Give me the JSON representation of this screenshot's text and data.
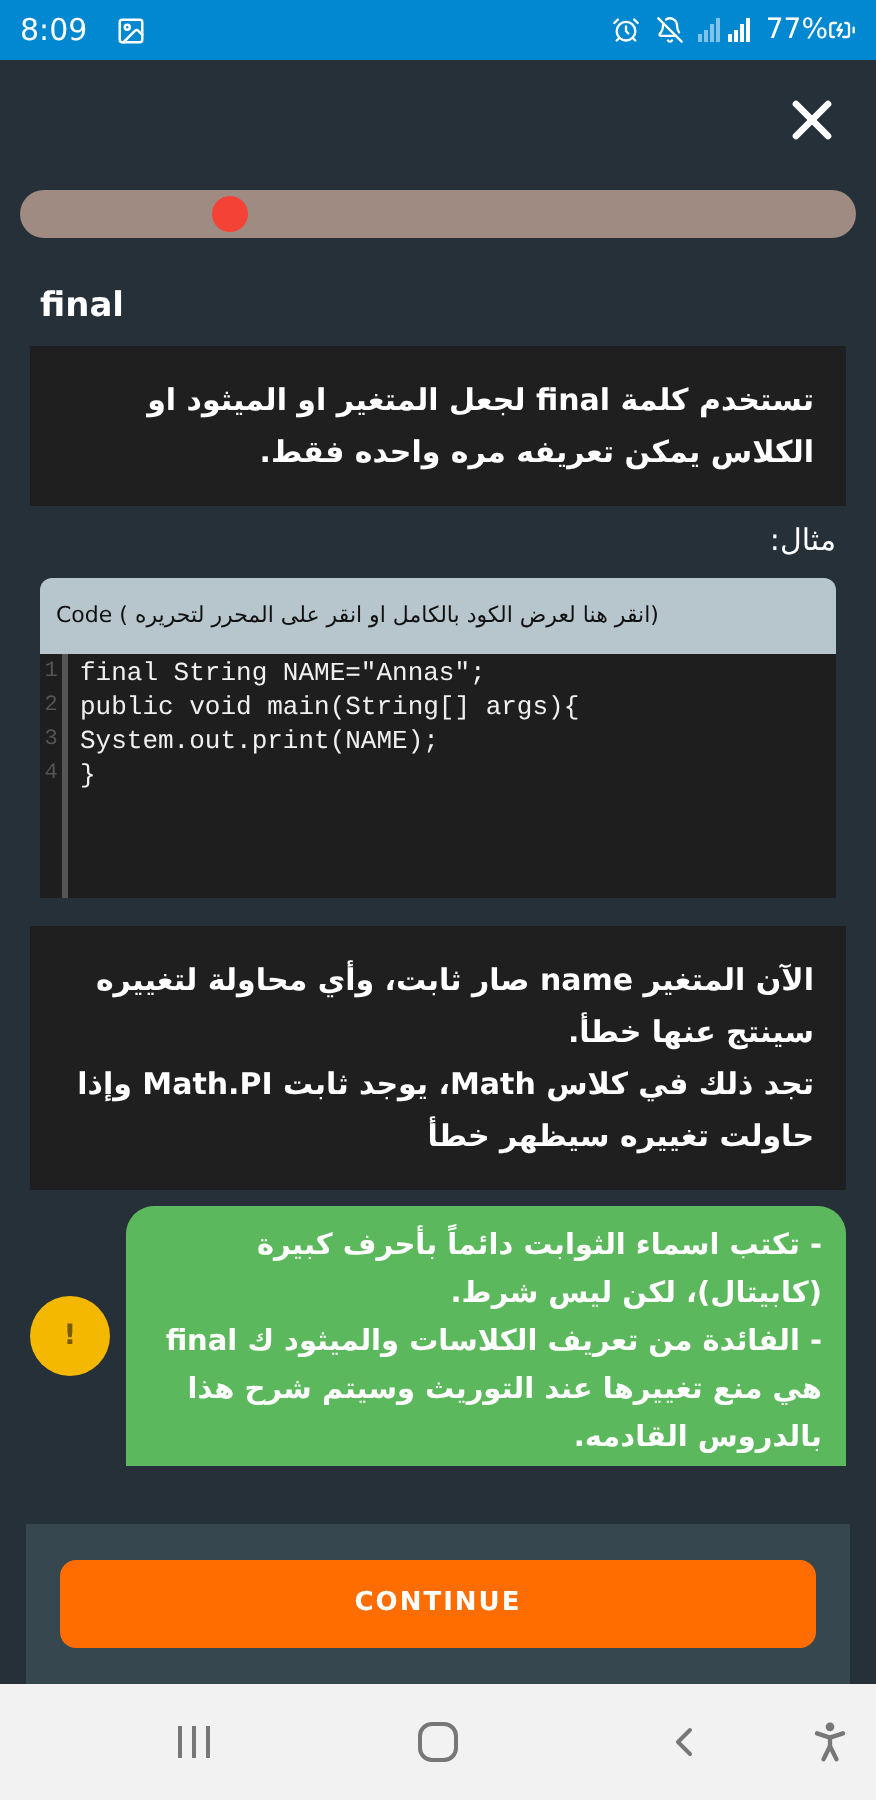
{
  "status_bar": {
    "time": "8:09",
    "battery": "77%"
  },
  "progress": {
    "level": 0.25
  },
  "title": "final",
  "intro": "تستخدم كلمة **final** لجعل المتغير او الميثود او الكلاس يمكن تعريفه مره واحده فقط.",
  "example_label": "مثال:",
  "code": {
    "header": "(انقر هنا لعرض الكود بالكامل او انقر على المحرر لتحريره ) Code",
    "lines": [
      {
        "number": "1",
        "text": "final String NAME=\"Annas\";"
      },
      {
        "number": "2",
        "text": "public void main(String[] args){"
      },
      {
        "number": "3",
        "text": "System.out.print(NAME);"
      },
      {
        "number": "4",
        "text": "}"
      }
    ]
  },
  "explanation": [
    "الآن المتغير **name** صار ثابت، وأي محاولة لتغييره سينتج عنها خطأ.",
    "تجد ذلك في كلاس **Math**، يوجد ثابت **Math.PI** وإذا حاولت تغييره سيظهر خطأ"
  ],
  "tip": {
    "badge": "!",
    "paragraphs": [
      "- تكتب اسماء الثوابت دائماً بأحرف كبيرة (كابيتال)، لكن ليس شرط.",
      "- الفائدة من تعريف الكلاسات والميثود ك **final** هي منع تغييرها عند التوريث وسيتم شرح هذا بالدروس القادمه."
    ]
  },
  "continue_button": "CONTINUE"
}
